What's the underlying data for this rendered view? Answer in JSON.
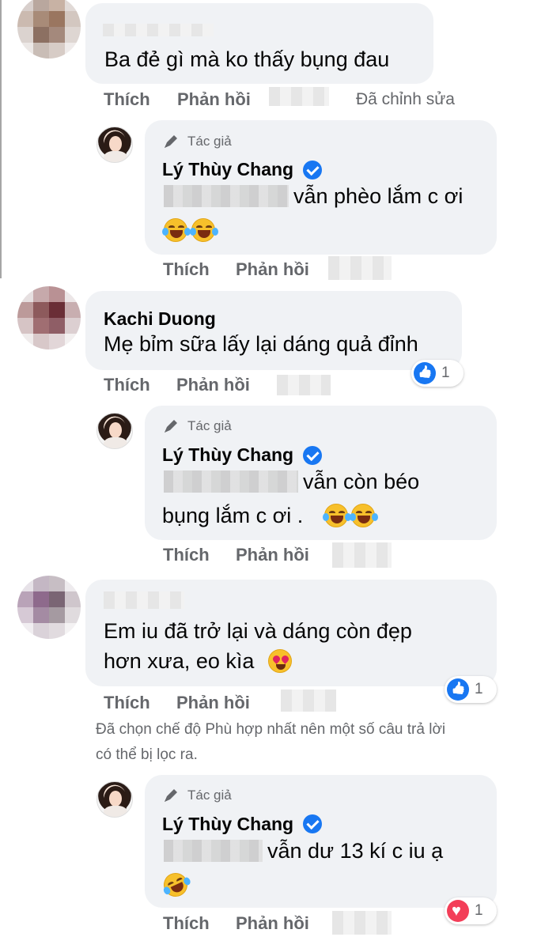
{
  "comments": [
    {
      "text": "Ba đẻ gì mà ko thấy bụng đau",
      "actions": {
        "like": "Thích",
        "reply": "Phản hồi"
      },
      "edited": "Đã chỉnh sửa"
    },
    {
      "author_tag": "Tác giả",
      "name": "Lý Thùy Chang",
      "text": "vẫn phèo lắm c ơi",
      "emoji": [
        "laughing-crying",
        "laughing-crying"
      ],
      "actions": {
        "like": "Thích",
        "reply": "Phản hồi"
      }
    },
    {
      "name": "Kachi Duong",
      "text": "Mẹ bỉm sữa lấy lại dáng quả đỉnh",
      "reaction": {
        "icon": "like-icon",
        "count": "1"
      },
      "actions": {
        "like": "Thích",
        "reply": "Phản hồi"
      }
    },
    {
      "author_tag": "Tác giả",
      "name": "Lý Thùy Chang",
      "text_line1": "vẫn còn béo",
      "text_line2": "bụng lắm c ơi .",
      "emoji": [
        "laughing-crying",
        "laughing-crying"
      ],
      "actions": {
        "like": "Thích",
        "reply": "Phản hồi"
      }
    },
    {
      "text_line1": "Em iu đã trở lại và dáng còn đẹp",
      "text_line2": "hơn xưa, eo kìa",
      "emoji": [
        "heart-eyes"
      ],
      "reaction": {
        "icon": "like-icon",
        "count": "1"
      },
      "actions": {
        "like": "Thích",
        "reply": "Phản hồi"
      }
    },
    {
      "author_tag": "Tác giả",
      "name": "Lý Thùy Chang",
      "text": "vẫn dư 13 kí c iu ạ",
      "emoji": [
        "rolling-laughing"
      ],
      "reaction": {
        "icon": "heart-icon",
        "count": "1"
      },
      "actions": {
        "like": "Thích",
        "reply": "Phản hồi"
      }
    }
  ],
  "filter_note_line1": "Đã chọn chế độ Phù hợp nhất nên một số câu trả lời",
  "filter_note_line2": "có thể bị lọc ra.",
  "colors": {
    "bubble": "#f0f2f5",
    "secondary_text": "#65676b",
    "verified": "#1877f2",
    "like": "#1877f2",
    "love": "#f33e58"
  }
}
